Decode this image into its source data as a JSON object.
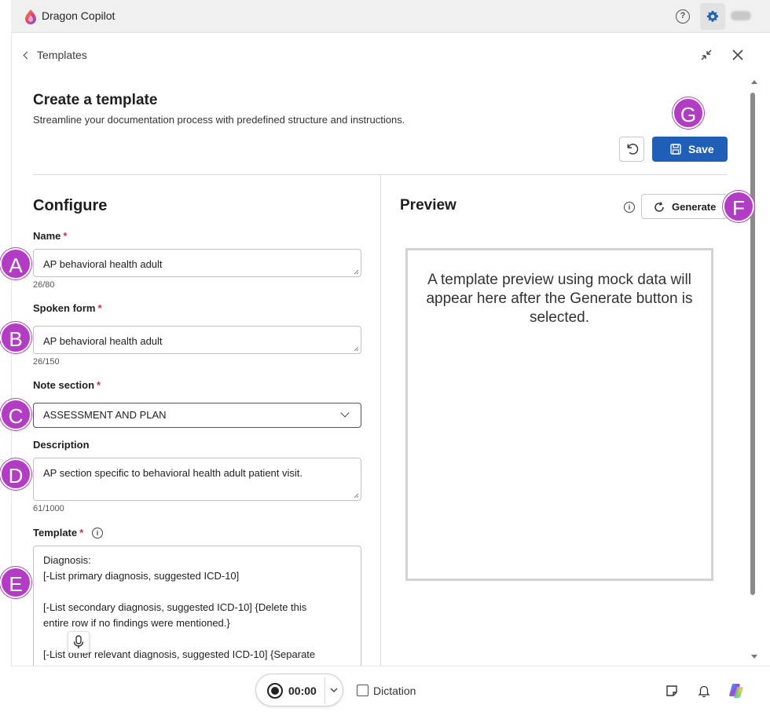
{
  "app": {
    "title": "Dragon Copilot"
  },
  "nav": {
    "back_label": "Templates"
  },
  "page": {
    "title": "Create a template",
    "subtitle": "Streamline your documentation process with predefined structure and instructions.",
    "save_label": "Save"
  },
  "configure": {
    "heading": "Configure",
    "name": {
      "label": "Name",
      "required": "*",
      "value": "AP behavioral health adult",
      "counter": "26/80"
    },
    "spoken_form": {
      "label": "Spoken form",
      "required": "*",
      "value": "AP behavioral health adult",
      "counter": "26/150"
    },
    "note_section": {
      "label": "Note section",
      "required": "*",
      "selected": "ASSESSMENT AND PLAN"
    },
    "description": {
      "label": "Description",
      "value": "AP section specific to behavioral health adult patient visit.",
      "counter": "61/1000"
    },
    "template": {
      "label": "Template",
      "required": "*",
      "lines": [
        "Diagnosis:",
        "[-List primary diagnosis, suggested ICD-10]",
        "",
        "[-List secondary diagnosis, suggested ICD-10] {Delete this",
        "entire row if no findings were mentioned.}",
        "",
        "[-List other relevant diagnosis, suggested ICD-10] {Separate"
      ]
    }
  },
  "preview": {
    "heading": "Preview",
    "generate_label": "Generate",
    "placeholder": "A template preview using mock data will appear here after the Generate button is selected."
  },
  "callouts": {
    "a": "A",
    "b": "B",
    "c": "C",
    "d": "D",
    "e": "E",
    "f": "F",
    "g": "G"
  },
  "bottom": {
    "timer": "00:00",
    "dictation_label": "Dictation"
  },
  "icons": [
    "dragon-logo-icon",
    "help-icon",
    "settings-icon",
    "chevron-left-icon",
    "minimize-icon",
    "close-icon",
    "undo-icon",
    "save-icon",
    "info-icon",
    "refresh-icon",
    "chevron-down-icon",
    "microphone-icon",
    "record-icon",
    "sticky-note-icon",
    "bell-icon",
    "copilot-icon"
  ],
  "colors": {
    "primary": "#1f5fb8",
    "callout": "#b33cc5",
    "required": "#c4314b"
  }
}
